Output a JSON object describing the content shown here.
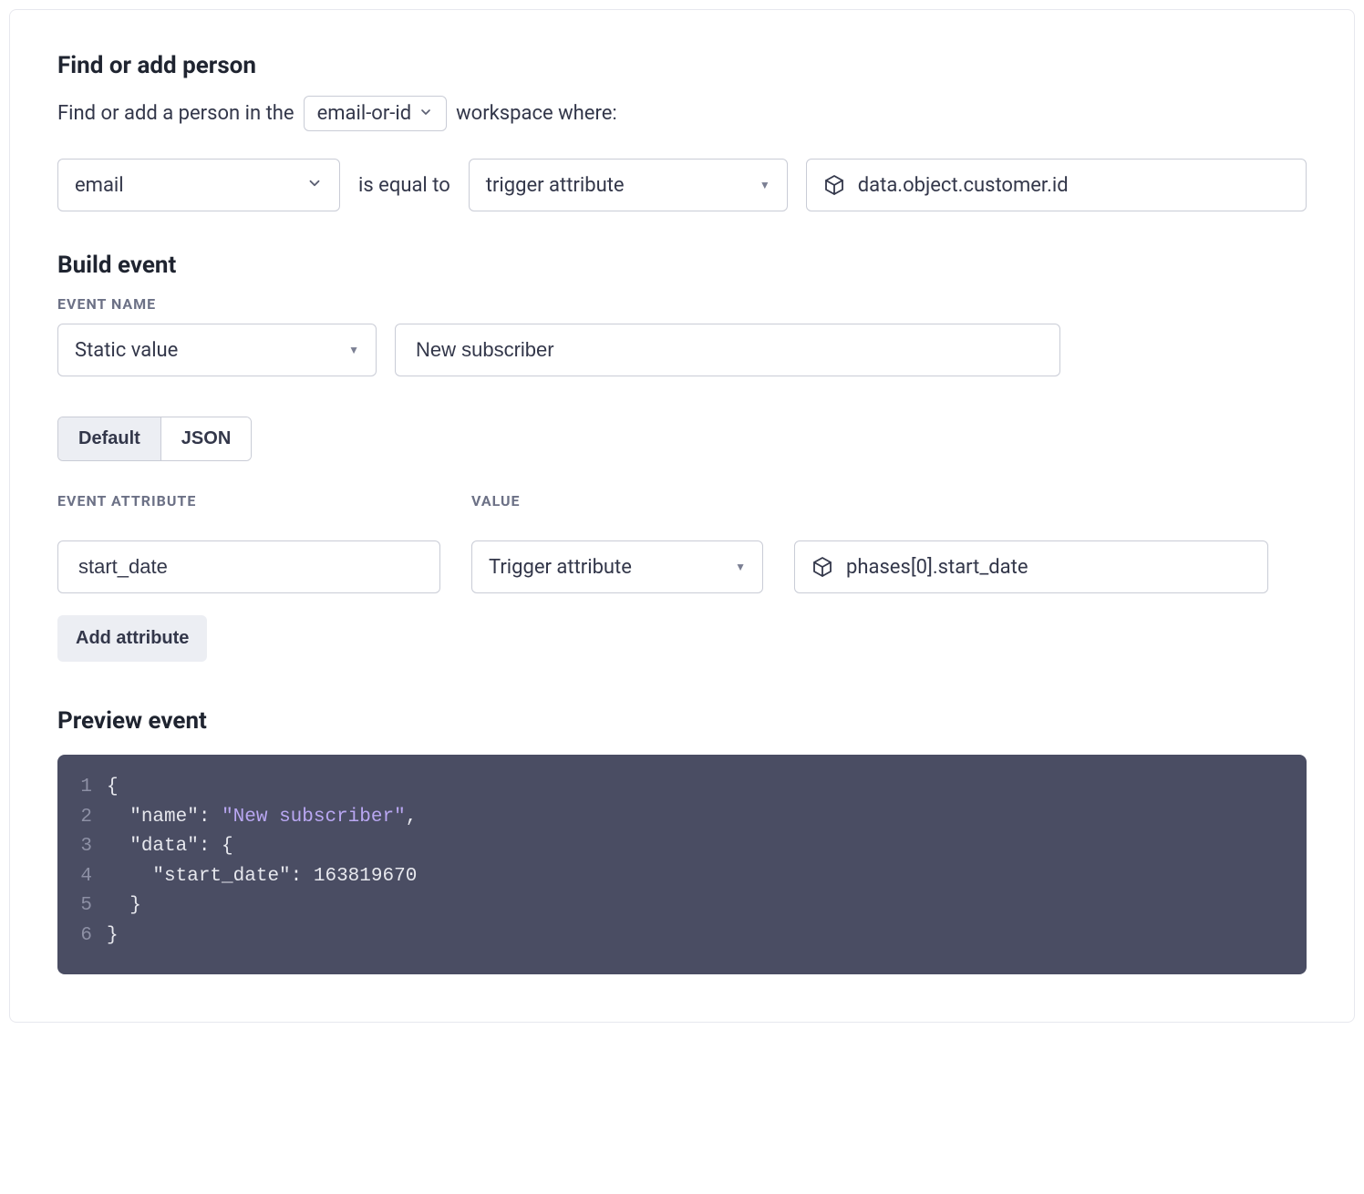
{
  "find_person": {
    "title": "Find or add person",
    "text_before": "Find or add a person in the",
    "workspace_selector": "email-or-id",
    "text_after": "workspace where:",
    "attribute": "email",
    "operator": "is equal to",
    "match_type": "trigger attribute",
    "path": "data.object.customer.id"
  },
  "build_event": {
    "title": "Build event",
    "event_name_label": "Event Name",
    "event_name_type": "Static value",
    "event_name_value": "New subscriber",
    "tabs": {
      "default": "Default",
      "json": "JSON"
    },
    "attr_label": "Event Attribute",
    "value_label": "Value",
    "attr_name": "start_date",
    "value_type": "Trigger attribute",
    "value_path": "phases[0].start_date",
    "add_button": "Add attribute"
  },
  "preview": {
    "title": "Preview event",
    "lines": [
      {
        "n": "1",
        "content": "{"
      },
      {
        "n": "2",
        "content": "  \"name\": \"New subscriber\","
      },
      {
        "n": "3",
        "content": "  \"data\": {"
      },
      {
        "n": "4",
        "content": "    \"start_date\": 163819670"
      },
      {
        "n": "5",
        "content": "  }"
      },
      {
        "n": "6",
        "content": "}"
      }
    ]
  }
}
